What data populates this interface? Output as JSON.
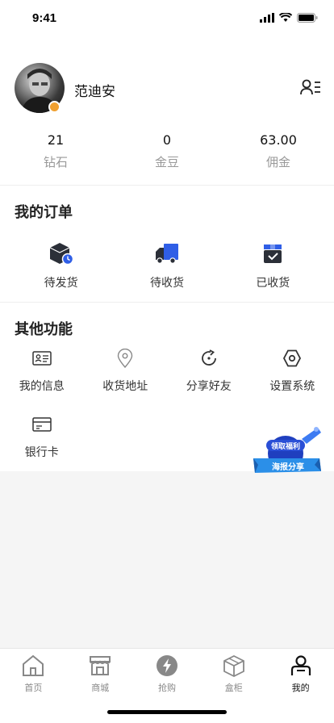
{
  "status_bar": {
    "time": "9:41"
  },
  "profile": {
    "name": "范迪安"
  },
  "stats": [
    {
      "value": "21",
      "label": "钻石"
    },
    {
      "value": "0",
      "label": "金豆"
    },
    {
      "value": "63.00",
      "label": "佣金"
    }
  ],
  "orders": {
    "title": "我的订单",
    "items": [
      {
        "label": "待发货",
        "icon": "box-clock-icon"
      },
      {
        "label": "待收货",
        "icon": "truck-icon"
      },
      {
        "label": "已收货",
        "icon": "box-check-icon"
      }
    ]
  },
  "functions": {
    "title": "其他功能",
    "items": [
      {
        "label": "我的信息",
        "icon": "id-card-icon"
      },
      {
        "label": "收货地址",
        "icon": "location-pin-icon"
      },
      {
        "label": "分享好友",
        "icon": "refresh-share-icon"
      },
      {
        "label": "设置系统",
        "icon": "hexagon-settings-icon"
      },
      {
        "label": "银行卡",
        "icon": "bank-card-icon"
      }
    ]
  },
  "promo": {
    "line1": "领取福利",
    "line2": "海报分享"
  },
  "tab_bar": {
    "items": [
      {
        "label": "首页",
        "icon": "home-icon"
      },
      {
        "label": "商城",
        "icon": "store-icon"
      },
      {
        "label": "抢购",
        "icon": "lightning-icon"
      },
      {
        "label": "盒柜",
        "icon": "cube-box-icon"
      },
      {
        "label": "我的",
        "icon": "person-icon"
      }
    ],
    "active": "我的"
  },
  "colors": {
    "accent_blue": "#2f5ee6",
    "badge_orange": "#f0a030",
    "dark_icon": "#2b2f38"
  }
}
